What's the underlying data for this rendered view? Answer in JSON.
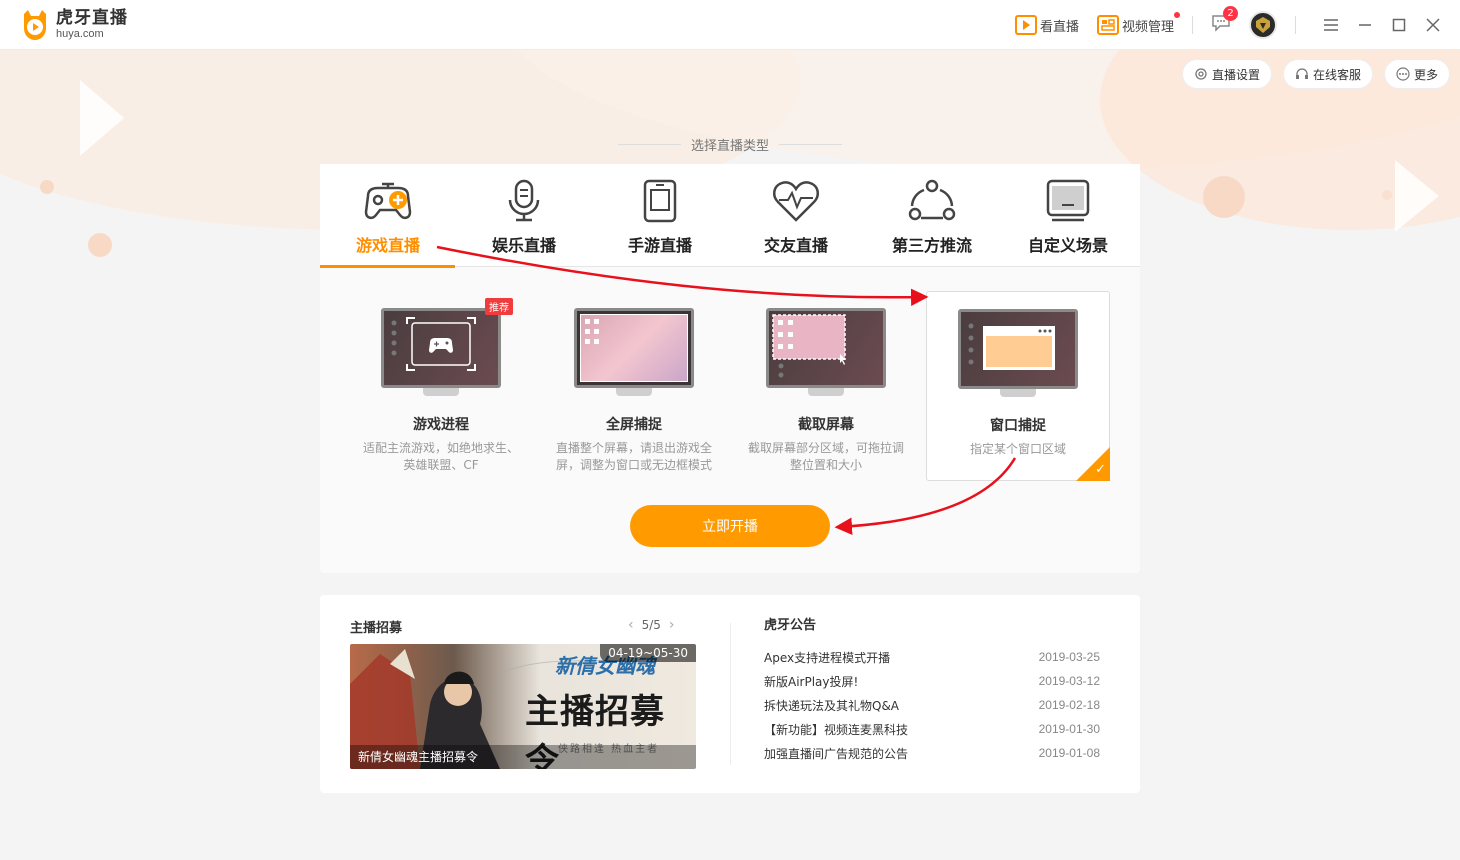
{
  "app": {
    "logo_cn": "虎牙直播",
    "logo_en": "huya.com"
  },
  "topbar": {
    "watch_label": "看直播",
    "video_manage_label": "视频管理",
    "message_count": "2"
  },
  "sub_actions": {
    "settings_label": "直播设置",
    "service_label": "在线客服",
    "more_label": "更多"
  },
  "choose_title": "选择直播类型",
  "tabs": [
    {
      "label": "游戏直播",
      "icon": "gamepad-icon",
      "active": true
    },
    {
      "label": "娱乐直播",
      "icon": "microphone-icon"
    },
    {
      "label": "手游直播",
      "icon": "tablet-icon"
    },
    {
      "label": "交友直播",
      "icon": "heartbeat-icon"
    },
    {
      "label": "第三方推流",
      "icon": "share-nodes-icon"
    },
    {
      "label": "自定义场景",
      "icon": "monitor-icon"
    }
  ],
  "modes": [
    {
      "title": "游戏进程",
      "desc": "适配主流游戏，如绝地求生、英雄联盟、CF",
      "badge": "推荐"
    },
    {
      "title": "全屏捕捉",
      "desc": "直播整个屏幕，请退出游戏全屏，调整为窗口或无边框模式"
    },
    {
      "title": "截取屏幕",
      "desc": "截取屏幕部分区域，可拖拉调整位置和大小"
    },
    {
      "title": "窗口捕捉",
      "desc": "指定某个窗口区域",
      "selected": true
    }
  ],
  "start_button": "立即开播",
  "recruit": {
    "title": "主播招募",
    "pager": "5/5",
    "banner_date": "04-19~05-30",
    "banner_caption": "新倩女幽魂主播招募令",
    "banner_logo": "新倩女幽魂",
    "banner_headline": "主播招募令",
    "banner_slogan": "侠路相逢 热血主者"
  },
  "notices": {
    "title": "虎牙公告",
    "items": [
      {
        "text": "Apex支持进程模式开播",
        "date": "2019-03-25"
      },
      {
        "text": "新版AirPlay投屏!",
        "date": "2019-03-12"
      },
      {
        "text": "拆快递玩法及其礼物Q&A",
        "date": "2019-02-18"
      },
      {
        "text": "【新功能】视频连麦黑科技",
        "date": "2019-01-30"
      },
      {
        "text": "加强直播间广告规范的公告",
        "date": "2019-01-08"
      }
    ]
  },
  "colors": {
    "accent": "#ff8f00",
    "button": "#ff9a00",
    "badge": "#f03c3c",
    "annotation": "#e8101b"
  }
}
